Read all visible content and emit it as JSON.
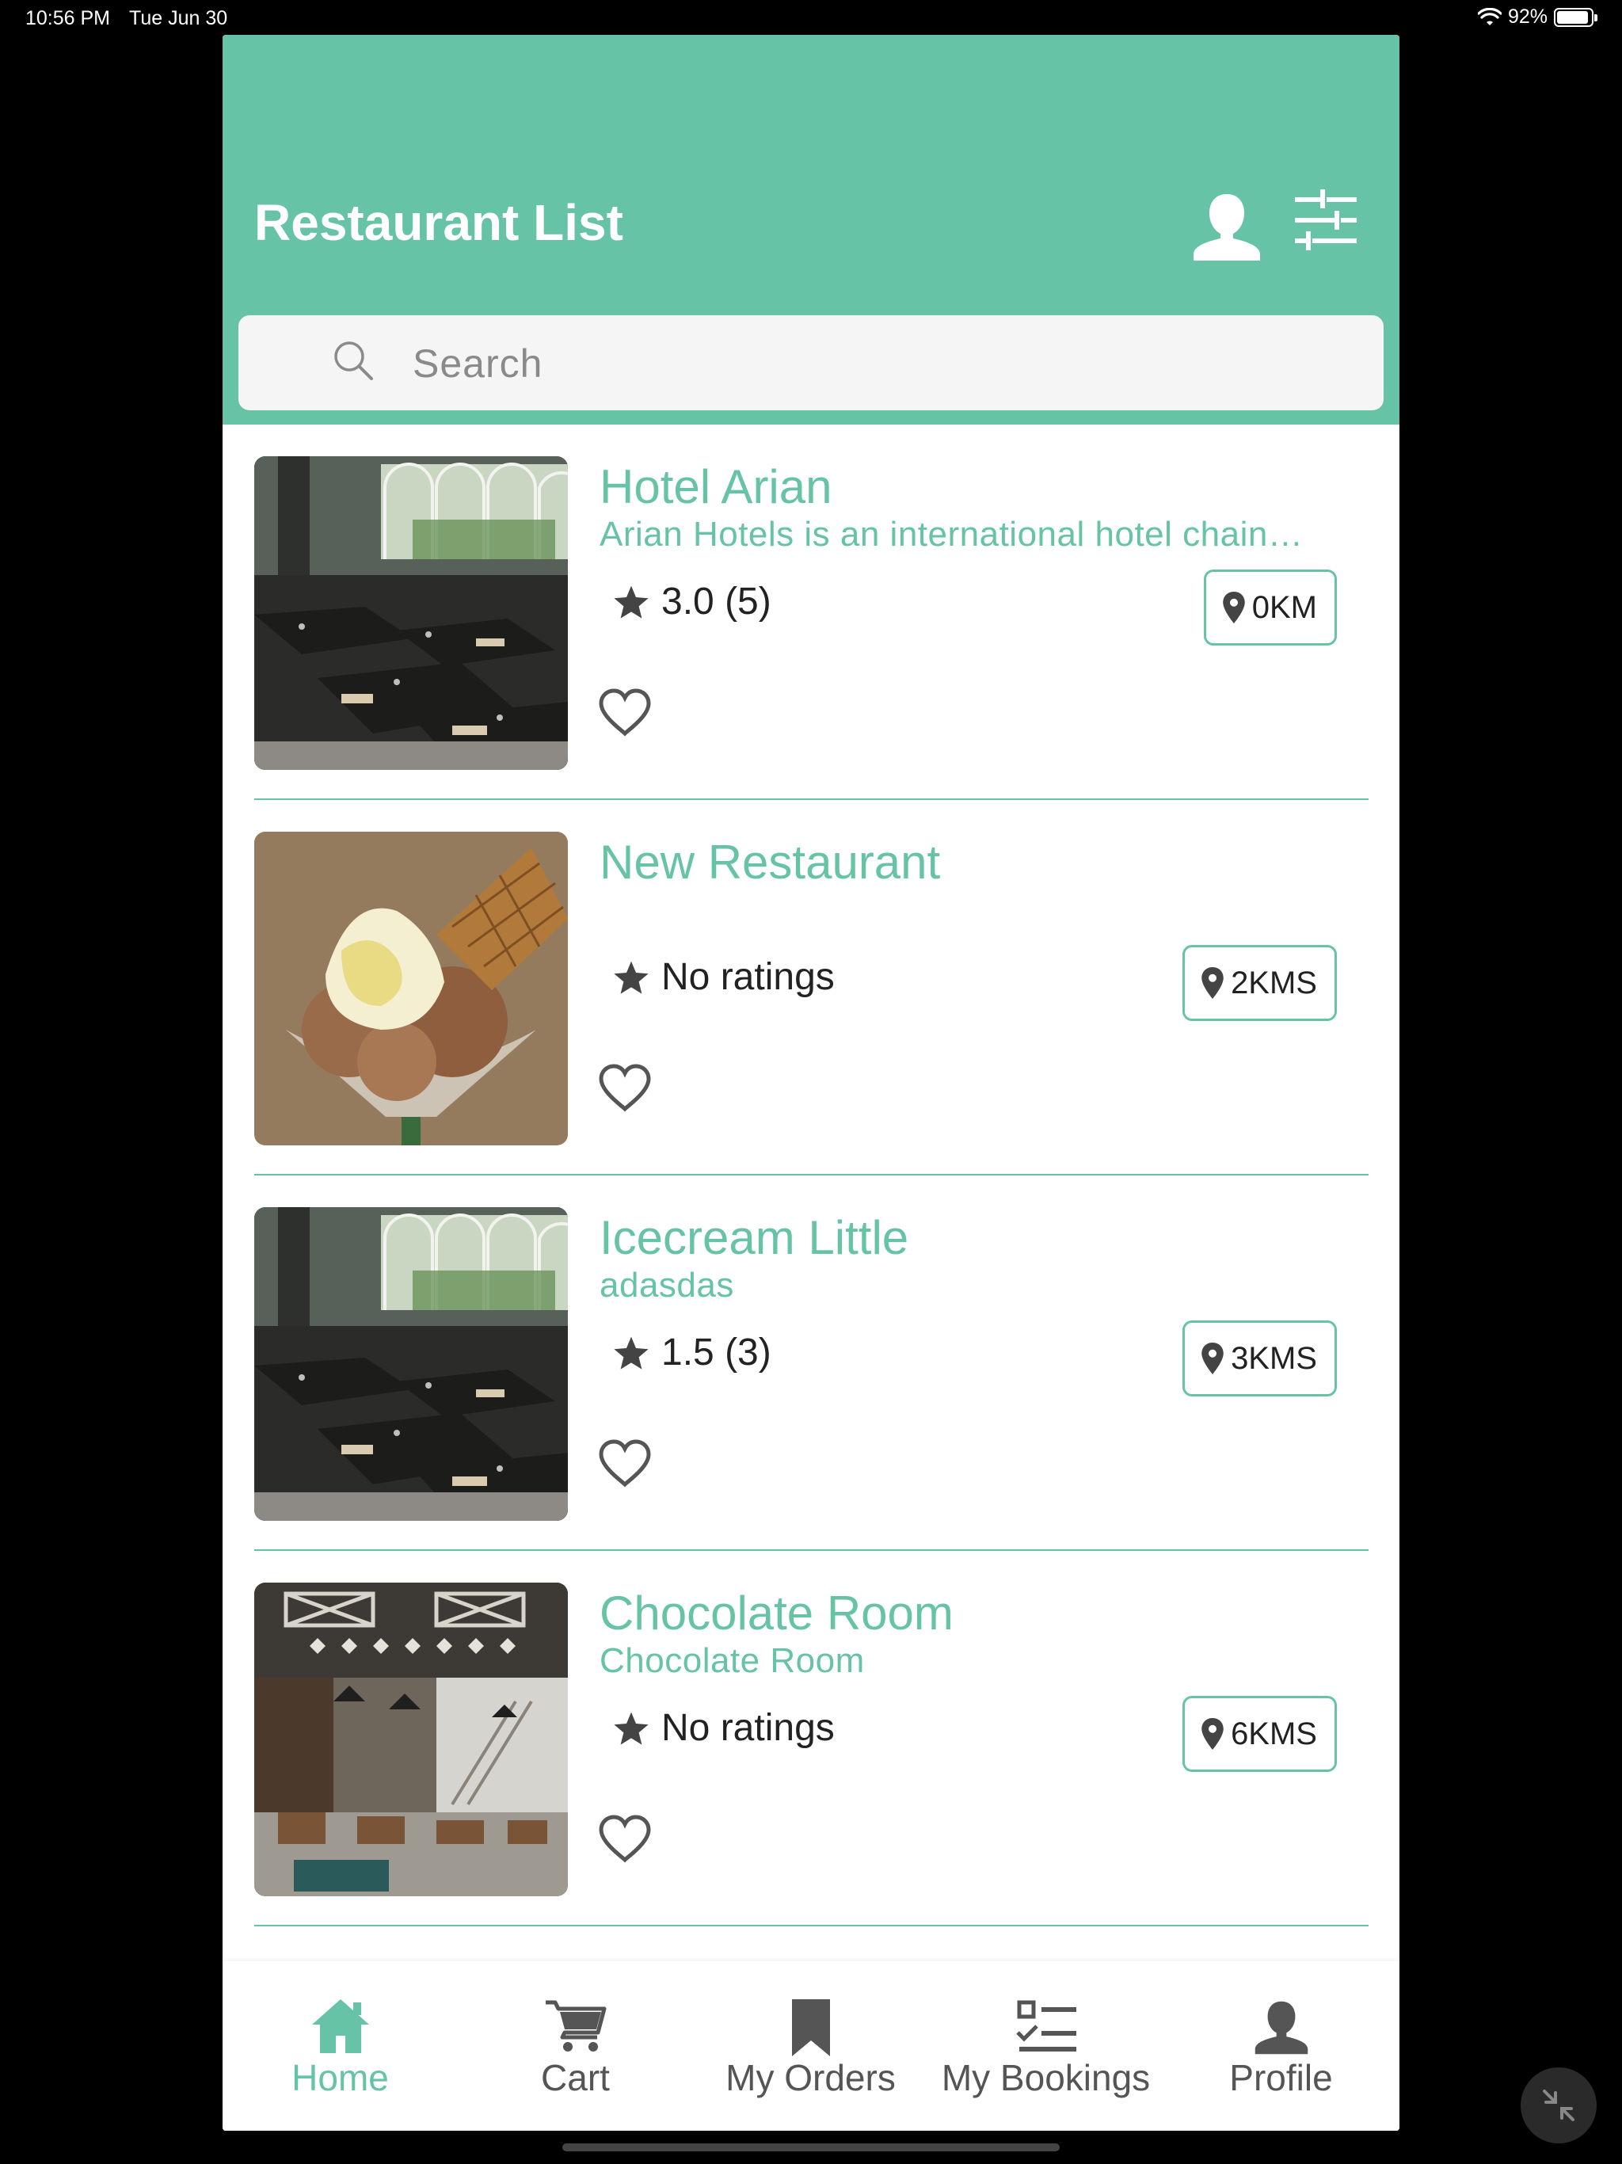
{
  "status_bar": {
    "time": "10:56 PM",
    "date": "Tue Jun 30",
    "battery": "92%",
    "battery_level": 0.92
  },
  "header": {
    "title": "Restaurant List",
    "profile_icon": "user-icon",
    "filter_icon": "sliders-icon"
  },
  "search": {
    "placeholder": "Search"
  },
  "colors": {
    "accent": "#66c3a5",
    "text": "#222222",
    "tab_inactive": "#555555"
  },
  "restaurants": [
    {
      "name": "Hotel Arian",
      "description": "Arian Hotels is an international hotel chain…",
      "rating": "3.0 (5)",
      "distance": "0KM",
      "image": "restaurant-interior"
    },
    {
      "name": "New Restaurant",
      "description": "",
      "rating": "No ratings",
      "distance": "2KMS",
      "image": "ice-cream-sundae"
    },
    {
      "name": "Icecream Little",
      "description": "adasdas",
      "rating": "1.5 (3)",
      "distance": "3KMS",
      "image": "restaurant-interior"
    },
    {
      "name": "Chocolate Room",
      "description": "Chocolate Room",
      "rating": "No ratings",
      "distance": "6KMS",
      "image": "industrial-cafe"
    }
  ],
  "tabs": [
    {
      "label": "Home",
      "icon": "home-icon",
      "active": true
    },
    {
      "label": "Cart",
      "icon": "cart-icon",
      "active": false
    },
    {
      "label": "My Orders",
      "icon": "bookmark-icon",
      "active": false
    },
    {
      "label": "My Bookings",
      "icon": "checklist-icon",
      "active": false
    },
    {
      "label": "Profile",
      "icon": "user-icon",
      "active": false
    }
  ]
}
